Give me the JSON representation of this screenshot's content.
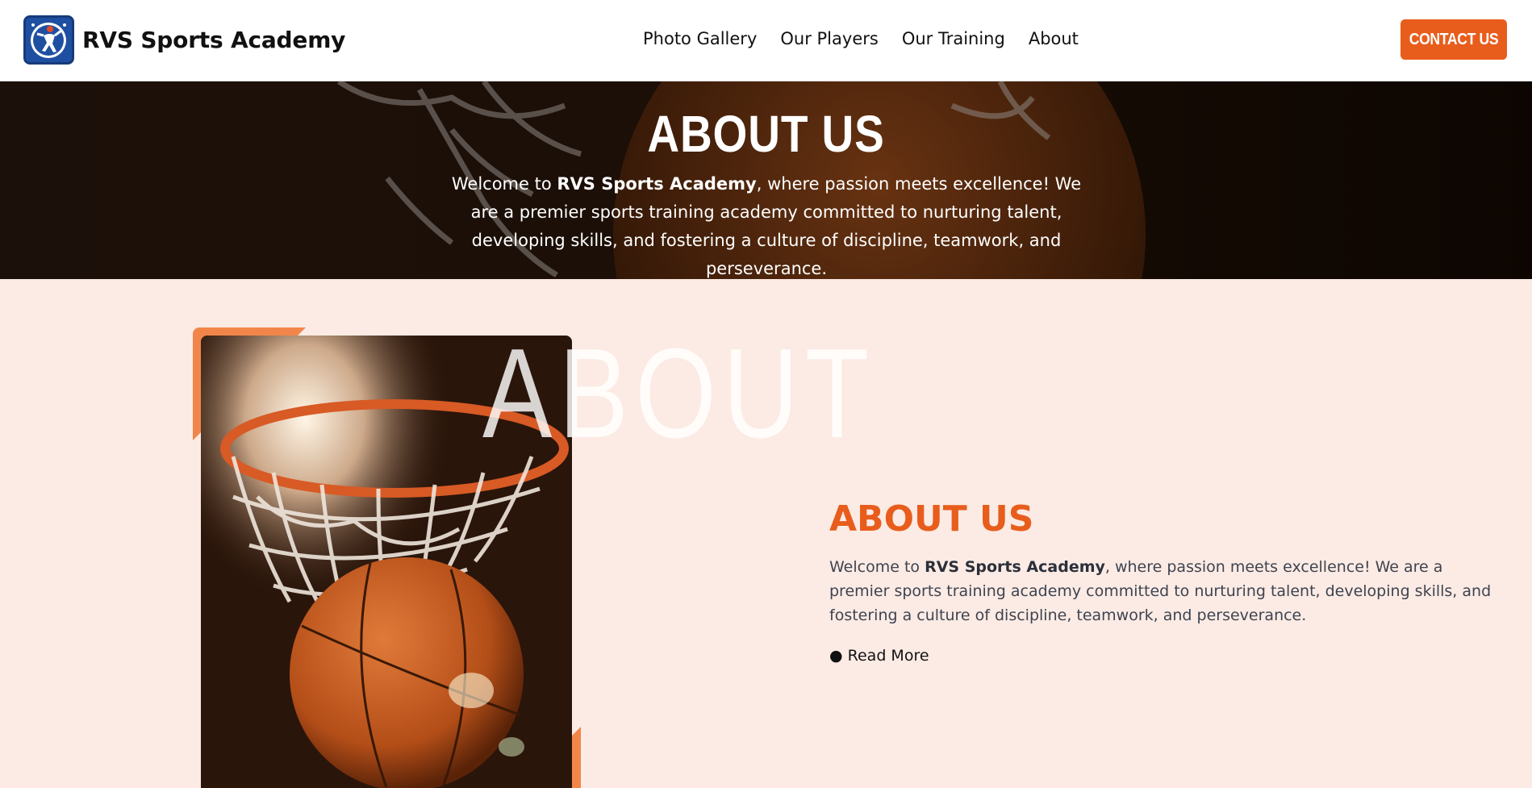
{
  "header": {
    "brand_name": "RVS Sports Academy",
    "nav": [
      {
        "label": "Photo Gallery"
      },
      {
        "label": "Our Players"
      },
      {
        "label": "Our Training"
      },
      {
        "label": "About"
      }
    ],
    "contact_label": "CONTACT US"
  },
  "hero": {
    "title": "ABOUT US",
    "text_prefix": "Welcome to ",
    "text_brand": "RVS Sports Academy",
    "text_suffix": ", where passion meets excellence! We are a premier sports training academy committed to nurturing talent, developing skills, and fostering a culture of discipline, teamwork, and perseverance."
  },
  "about": {
    "watermark": "ABOUT",
    "title": "ABOUT US",
    "text_prefix": "Welcome to ",
    "text_brand": "RVS Sports Academy",
    "text_suffix": ", where passion meets excellence! We are a premier sports training academy committed to nurturing talent, developing skills, and fostering a culture of discipline, teamwork, and perseverance.",
    "read_more_bullet": "●",
    "read_more_label": "Read More"
  },
  "colors": {
    "accent": "#e85d1c",
    "accent_light": "#f2864a",
    "section_bg": "#fbebe4",
    "logo_blue": "#1f4fa0"
  },
  "icons": {
    "logo": "basketball-player-logo-icon"
  }
}
